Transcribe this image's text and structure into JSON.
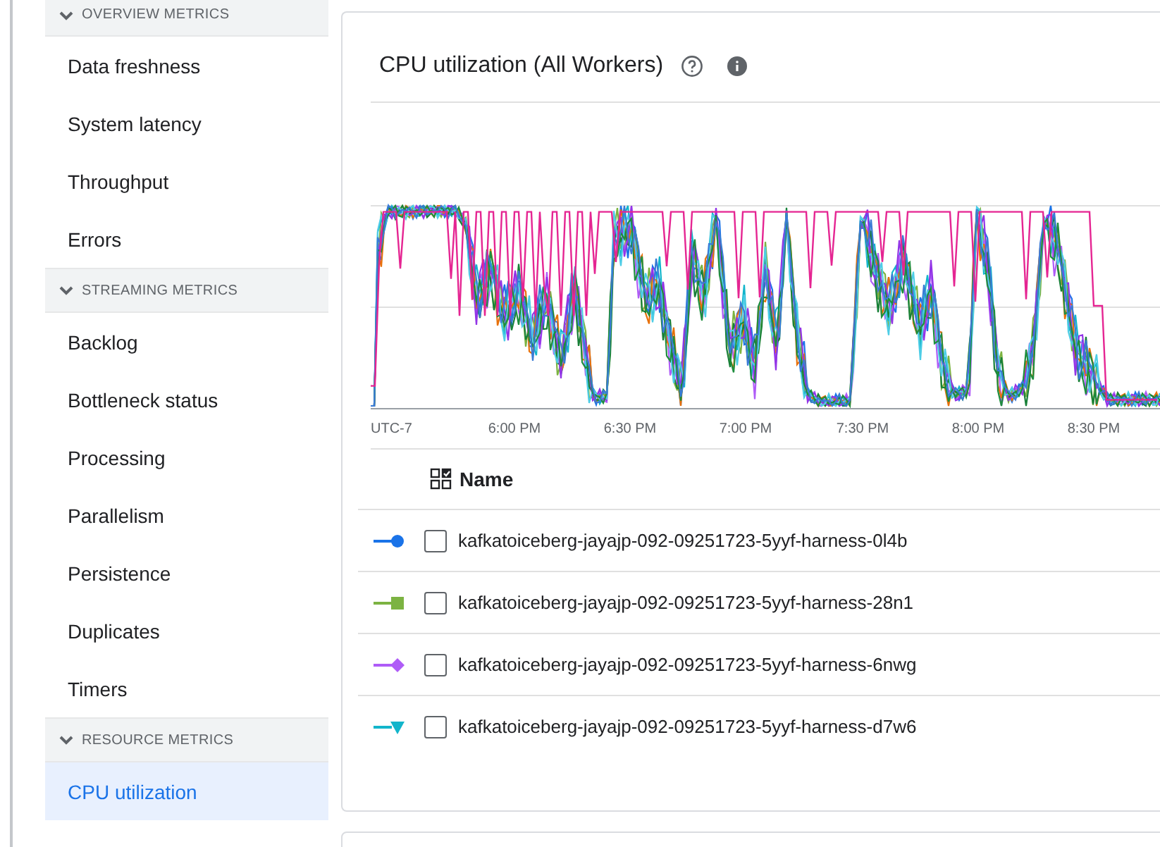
{
  "sidebar": {
    "sections": [
      {
        "title": "OVERVIEW METRICS",
        "expanded": true,
        "items": [
          {
            "label": "Data freshness",
            "selected": false
          },
          {
            "label": "System latency",
            "selected": false
          },
          {
            "label": "Throughput",
            "selected": false
          },
          {
            "label": "Errors",
            "selected": false
          }
        ]
      },
      {
        "title": "STREAMING METRICS",
        "expanded": true,
        "items": [
          {
            "label": "Backlog",
            "selected": false
          },
          {
            "label": "Bottleneck status",
            "selected": false
          },
          {
            "label": "Processing",
            "selected": false
          },
          {
            "label": "Parallelism",
            "selected": false
          },
          {
            "label": "Persistence",
            "selected": false
          },
          {
            "label": "Duplicates",
            "selected": false
          },
          {
            "label": "Timers",
            "selected": false
          }
        ]
      },
      {
        "title": "RESOURCE METRICS",
        "expanded": true,
        "items": [
          {
            "label": "CPU utilization",
            "selected": true
          }
        ]
      }
    ]
  },
  "chart": {
    "title": "CPU utilization (All Workers)",
    "x_ticks": [
      "UTC-7",
      "6:00 PM",
      "6:30 PM",
      "7:00 PM",
      "7:30 PM",
      "8:00 PM",
      "8:30 PM"
    ]
  },
  "legend": {
    "column": "Name",
    "rows": [
      {
        "name": "kafkatoiceberg-jayajp-092-09251723-5yyf-harness-0l4b",
        "color": "#1a73e8",
        "kind": "circle",
        "checked": false
      },
      {
        "name": "kafkatoiceberg-jayajp-092-09251723-5yyf-harness-28n1",
        "color": "#7cb342",
        "kind": "square",
        "checked": false
      },
      {
        "name": "kafkatoiceberg-jayajp-092-09251723-5yyf-harness-6nwg",
        "color": "#af5cf7",
        "kind": "diamond",
        "checked": false
      },
      {
        "name": "kafkatoiceberg-jayajp-092-09251723-5yyf-harness-d7w6",
        "color": "#12b5cb",
        "kind": "triangle",
        "checked": false
      }
    ]
  }
}
